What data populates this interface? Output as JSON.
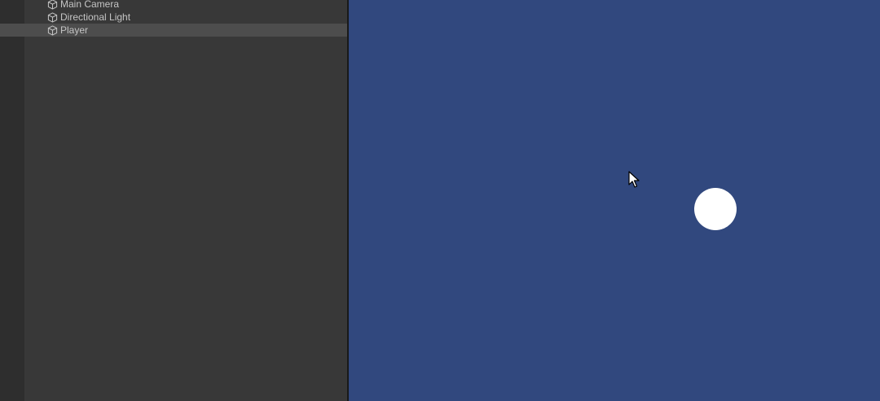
{
  "hierarchy": {
    "items": [
      {
        "label": "Main Camera",
        "icon": "gameobject-cube-icon",
        "selected": false
      },
      {
        "label": "Directional Light",
        "icon": "gameobject-cube-icon",
        "selected": false
      },
      {
        "label": "Player",
        "icon": "gameobject-cube-icon",
        "selected": true
      }
    ]
  },
  "game_view": {
    "background_color": "#31487e",
    "player_color": "#ffffff",
    "cursor_icon": "mouse-pointer-icon"
  },
  "colors": {
    "panel": "#383838",
    "selected_row": "#4d4d4d",
    "text": "#c4c4c4"
  }
}
